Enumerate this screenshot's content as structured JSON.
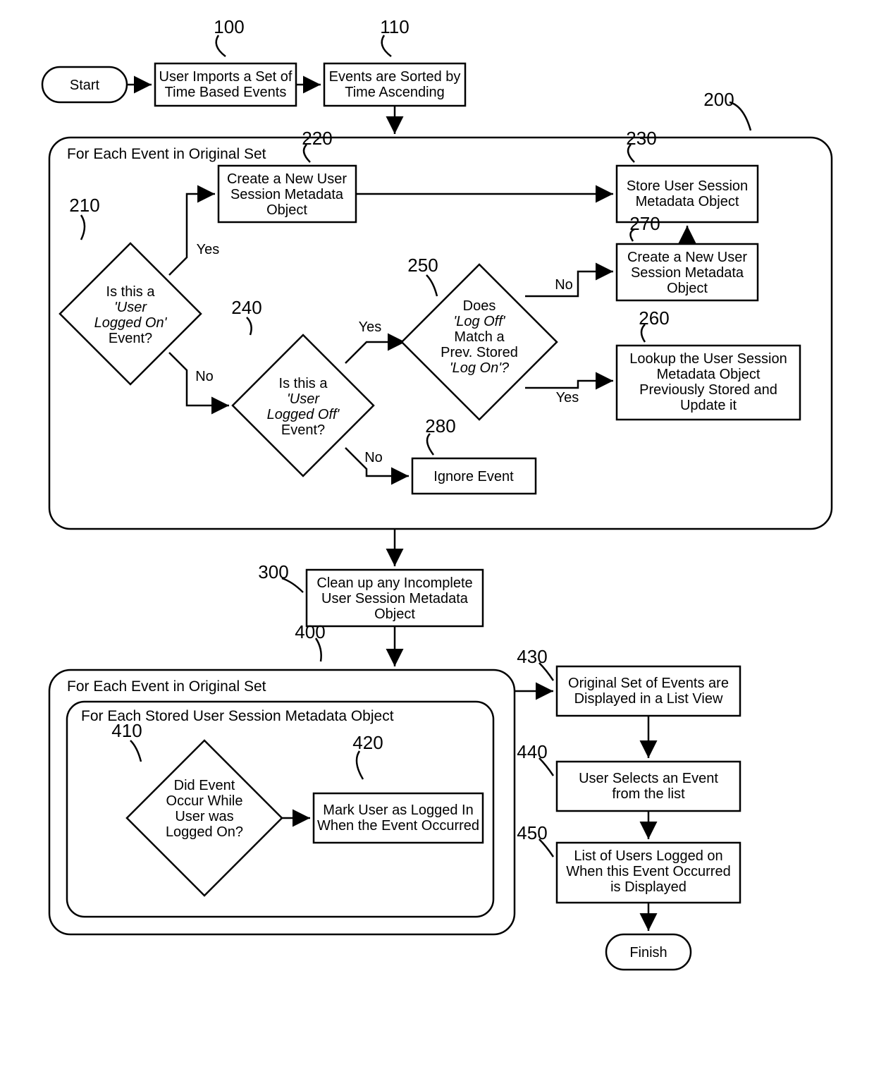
{
  "diagram": {
    "start": "Start",
    "finish": "Finish",
    "yes": "Yes",
    "no": "No",
    "n100": {
      "num": "100",
      "l1": "User Imports a Set of",
      "l2": "Time Based Events"
    },
    "n110": {
      "num": "110",
      "l1": "Events are Sorted by",
      "l2": "Time Ascending"
    },
    "g200": {
      "num": "200",
      "title": "For Each Event in Original Set"
    },
    "n210": {
      "num": "210",
      "l1": "Is this a",
      "l2": "'User",
      "l3": "Logged On'",
      "l4": "Event?"
    },
    "n220": {
      "num": "220",
      "l1": "Create a New User",
      "l2": "Session Metadata",
      "l3": "Object"
    },
    "n230": {
      "num": "230",
      "l1": "Store User Session",
      "l2": "Metadata Object"
    },
    "n240": {
      "num": "240",
      "l1": "Is this a",
      "l2": "'User",
      "l3": "Logged Off'",
      "l4": "Event?"
    },
    "n250": {
      "num": "250",
      "l1": "Does",
      "l2": "'Log Off'",
      "l3": "Match a",
      "l4": "Prev. Stored",
      "l5": "'Log On'?"
    },
    "n260": {
      "num": "260",
      "l1": "Lookup the User Session",
      "l2": "Metadata Object",
      "l3": "Previously Stored and",
      "l4": "Update it"
    },
    "n270": {
      "num": "270",
      "l1": "Create a New User",
      "l2": "Session Metadata",
      "l3": "Object"
    },
    "n280": {
      "num": "280",
      "l1": "Ignore Event"
    },
    "n300": {
      "num": "300",
      "l1": "Clean up any Incomplete",
      "l2": "User Session Metadata",
      "l3": "Object"
    },
    "g400": {
      "num": "400",
      "title": "For Each Event in Original Set",
      "inner": "For Each Stored User Session Metadata Object"
    },
    "n410": {
      "num": "410",
      "l1": "Did Event",
      "l2": "Occur While",
      "l3": "User was",
      "l4": "Logged On?"
    },
    "n420": {
      "num": "420",
      "l1": "Mark User as Logged In",
      "l2": "When the Event Occurred"
    },
    "n430": {
      "num": "430",
      "l1": "Original Set of Events are",
      "l2": "Displayed in a List View"
    },
    "n440": {
      "num": "440",
      "l1": "User Selects an Event",
      "l2": "from the list"
    },
    "n450": {
      "num": "450",
      "l1": "List of Users Logged on",
      "l2": "When this Event Occurred",
      "l3": "is Displayed"
    }
  }
}
